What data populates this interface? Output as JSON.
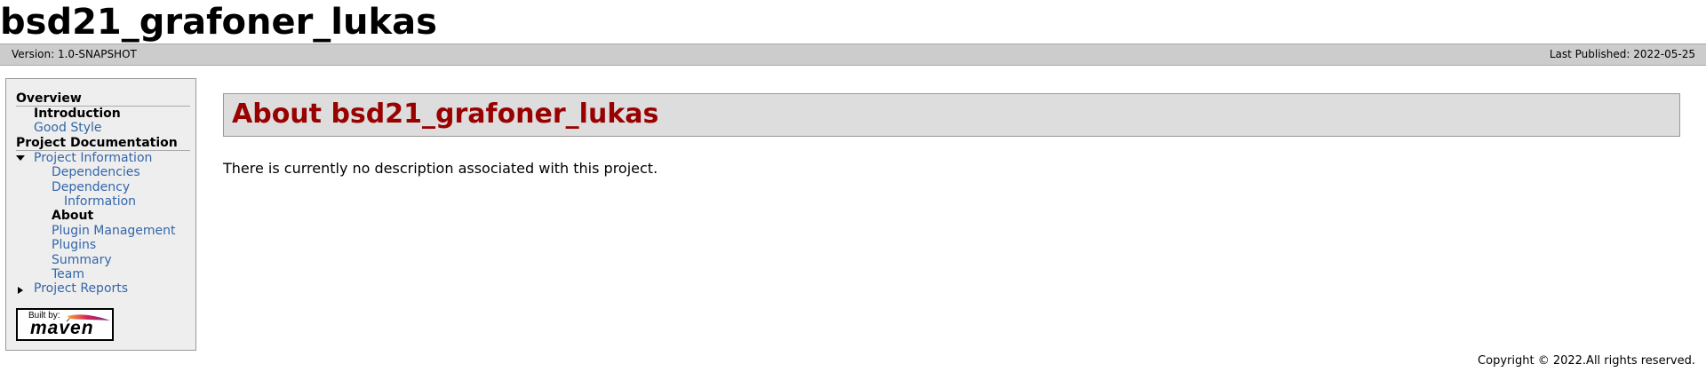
{
  "banner": {
    "title": "bsd21_grafoner_lukas"
  },
  "breadcrumbs": {
    "version": "Version: 1.0-SNAPSHOT",
    "published": "Last Published: 2022-05-25"
  },
  "sidebar": {
    "overview_heading": "Overview",
    "overview_items": [
      {
        "label": "Introduction",
        "active": true
      },
      {
        "label": "Good Style",
        "active": false
      }
    ],
    "project_doc_heading": "Project Documentation",
    "project_info": {
      "label": "Project Information",
      "expanded": true,
      "children": [
        {
          "label": "Dependencies"
        },
        {
          "label_line1": "Dependency",
          "label_line2": "Information"
        },
        {
          "label": "About",
          "active": true
        },
        {
          "label": "Plugin Management"
        },
        {
          "label": "Plugins"
        },
        {
          "label": "Summary"
        },
        {
          "label": "Team"
        }
      ]
    },
    "project_reports": {
      "label": "Project Reports",
      "expanded": false
    },
    "powered_by": {
      "built_by": "Built by:",
      "maven": "maven"
    }
  },
  "main": {
    "title": "About bsd21_grafoner_lukas",
    "description": "There is currently no description associated with this project."
  },
  "footer": {
    "copyright": "Copyright © 2022.All rights reserved."
  },
  "colors": {
    "link": "#3366aa",
    "title": "#990000",
    "breadcrumb_bg": "#cccccc",
    "sidebar_bg": "#eeeeee",
    "section_bg": "#dddddd"
  }
}
